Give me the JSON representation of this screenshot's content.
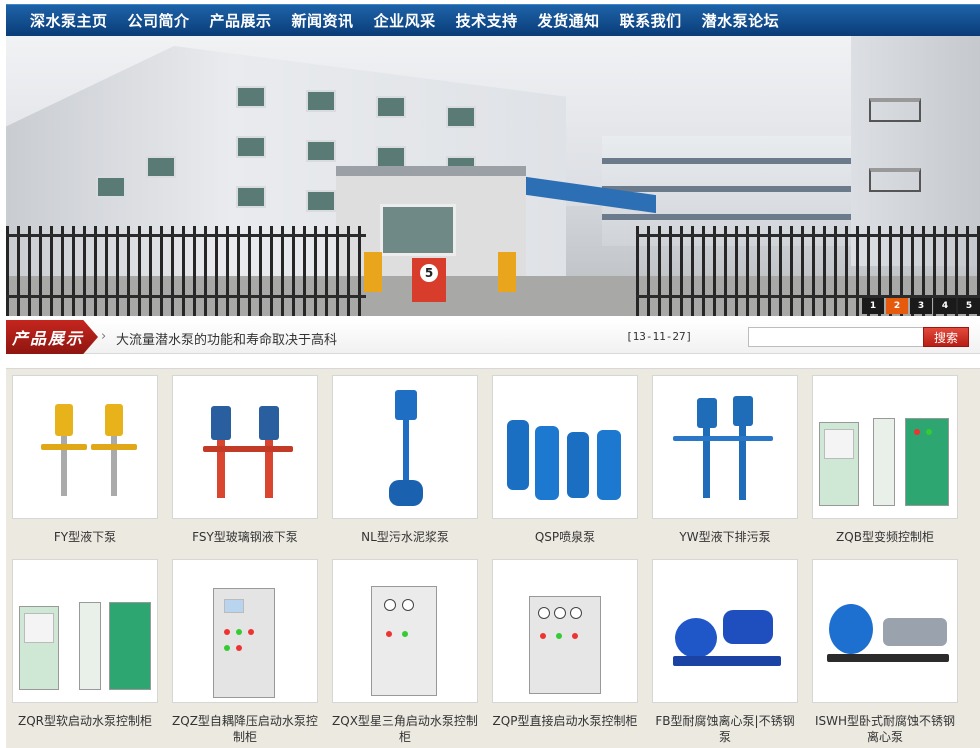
{
  "nav": {
    "items": [
      "深水泵主页",
      "公司简介",
      "产品展示",
      "新闻资讯",
      "企业风采",
      "技术支持",
      "发货通知",
      "联系我们",
      "潜水泵论坛"
    ]
  },
  "banner": {
    "slider": [
      "1",
      "2",
      "3",
      "4",
      "5"
    ],
    "active_slide": "2",
    "sign_text": "5"
  },
  "section": {
    "title": "产品展示",
    "news_text": "大流量潜水泵的功能和寿命取决于高科",
    "news_date": "[13-11-27]",
    "search_placeholder": "",
    "search_button": "搜索"
  },
  "products": [
    {
      "caption": "FY型液下泵",
      "icon": "vertical-pump-yellow"
    },
    {
      "caption": "FSY型玻璃钢液下泵",
      "icon": "vertical-pump-red"
    },
    {
      "caption": "NL型污水泥浆泵",
      "icon": "slurry-pump-blue"
    },
    {
      "caption": "QSP喷泉泵",
      "icon": "fountain-pumps-blue"
    },
    {
      "caption": "YW型液下排污泵",
      "icon": "sewage-pump-blue"
    },
    {
      "caption": "ZQB型变频控制柜",
      "icon": "control-cabinet-green"
    },
    {
      "caption": "ZQR型软启动水泵控制柜",
      "icon": "control-cabinet-green"
    },
    {
      "caption": "ZQZ型自耦降压启动水泵控制柜",
      "icon": "control-cabinet-gray"
    },
    {
      "caption": "ZQX型星三角启动水泵控制柜",
      "icon": "control-cabinet-gray"
    },
    {
      "caption": "ZQP型直接启动水泵控制柜",
      "icon": "control-cabinet-gray"
    },
    {
      "caption": "FB型耐腐蚀离心泵|不锈钢泵",
      "icon": "centrifugal-pump-blue"
    },
    {
      "caption": "ISWH型卧式耐腐蚀不锈钢离心泵",
      "icon": "horizontal-pump-blue"
    }
  ]
}
